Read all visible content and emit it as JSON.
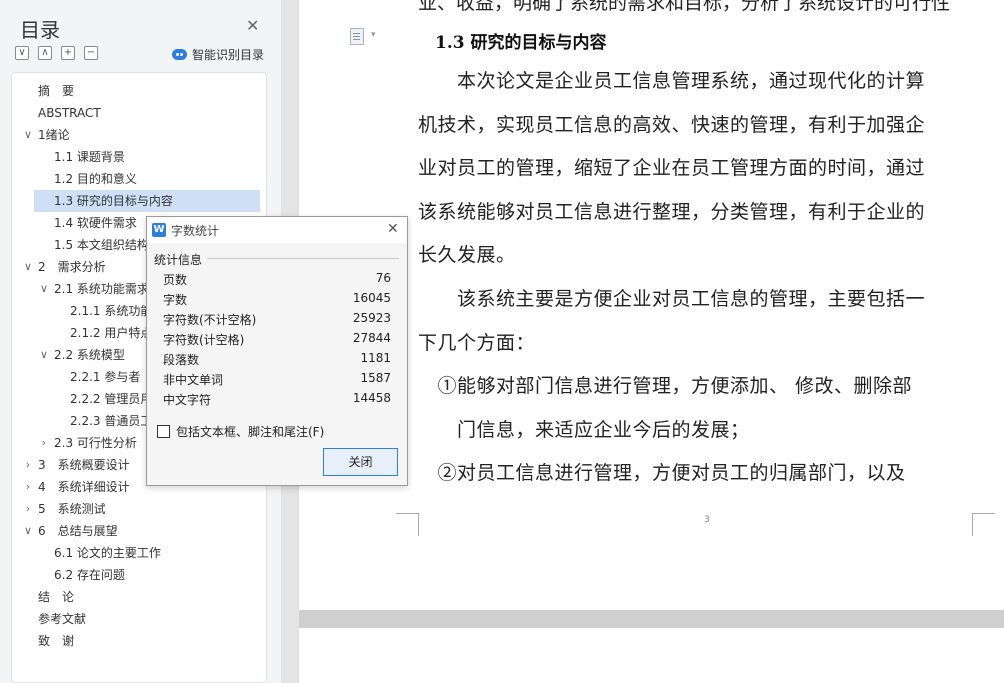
{
  "sidebar": {
    "title": "目录",
    "smart_label": "智能识别目录",
    "tools": [
      "∨",
      "∧",
      "+",
      "−"
    ],
    "items": [
      {
        "label": "摘　要",
        "level": 0
      },
      {
        "label": "ABSTRACT",
        "level": 0
      },
      {
        "label": "1绪论",
        "level": 0,
        "expanded": true
      },
      {
        "label": "1.1 课题背景",
        "level": 1
      },
      {
        "label": "1.2 目的和意义",
        "level": 1
      },
      {
        "label": "1.3 研究的目标与内容",
        "level": 1,
        "selected": true
      },
      {
        "label": "1.4 软硬件需求",
        "level": 1
      },
      {
        "label": "1.5 本文组织结构",
        "level": 1
      },
      {
        "label": "2　需求分析",
        "level": 0,
        "expanded": true
      },
      {
        "label": "2.1 系统功能需求",
        "level": 1,
        "expanded": true
      },
      {
        "label": "2.1.1 系统功能",
        "level": 2
      },
      {
        "label": "2.1.2 用户特点",
        "level": 2
      },
      {
        "label": "2.2 系统模型",
        "level": 1,
        "expanded": true
      },
      {
        "label": "2.2.1 参与者",
        "level": 2
      },
      {
        "label": "2.2.2 管理员用",
        "level": 2
      },
      {
        "label": "2.2.3 普通员工",
        "level": 2
      },
      {
        "label": "2.3 可行性分析",
        "level": 1,
        "expanded": false
      },
      {
        "label": "3　系统概要设计",
        "level": 0,
        "expanded": false
      },
      {
        "label": "4　系统详细设计",
        "level": 0,
        "expanded": false
      },
      {
        "label": "5　系统测试",
        "level": 0,
        "expanded": false
      },
      {
        "label": "6　总结与展望",
        "level": 0,
        "expanded": true
      },
      {
        "label": "6.1 论文的主要工作",
        "level": 1
      },
      {
        "label": "6.2 存在问题",
        "level": 1
      },
      {
        "label": "结　论",
        "level": 0
      },
      {
        "label": "参考文献",
        "level": 0
      },
      {
        "label": "致　谢",
        "level": 0
      }
    ]
  },
  "document": {
    "top_cut_line": "业、收益，明确了系统的需求和目标，分析了系统设计的可行性",
    "heading": "1.3 研究的目标与内容",
    "lines": [
      "　　本次论文是企业员工信息管理系统，通过现代化的计算",
      "机技术，实现员工信息的高效、快速的管理，有利于加强企",
      "业对员工的管理，缩短了企业在员工管理方面的时间，通过",
      "该系统能够对员工信息进行整理，分类管理，有利于企业的",
      "长久发展。",
      "　　该系统主要是方便企业对员工信息的管理，主要包括一",
      "下几个方面：",
      "　①能够对部门信息进行管理，方便添加、 修改、删除部",
      "　　门信息，来适应企业今后的发展；",
      "　②对员工信息进行管理，方便对员工的归属部门，以及"
    ],
    "page_number": "3"
  },
  "dialog": {
    "title": "字数统计",
    "section": "统计信息",
    "stats": [
      {
        "label": "页数",
        "value": "76"
      },
      {
        "label": "字数",
        "value": "16045"
      },
      {
        "label": "字符数(不计空格)",
        "value": "25923"
      },
      {
        "label": "字符数(计空格)",
        "value": "27844"
      },
      {
        "label": "段落数",
        "value": "1181"
      },
      {
        "label": "非中文单词",
        "value": "1587"
      },
      {
        "label": "中文字符",
        "value": "14458"
      }
    ],
    "checkbox_label": "包括文本框、脚注和尾注(F)",
    "checkbox_checked": false,
    "close_label": "关闭",
    "icon_letter": "W"
  },
  "colors": {
    "accent": "#2f7ddc",
    "selection": "#cfdff5"
  }
}
